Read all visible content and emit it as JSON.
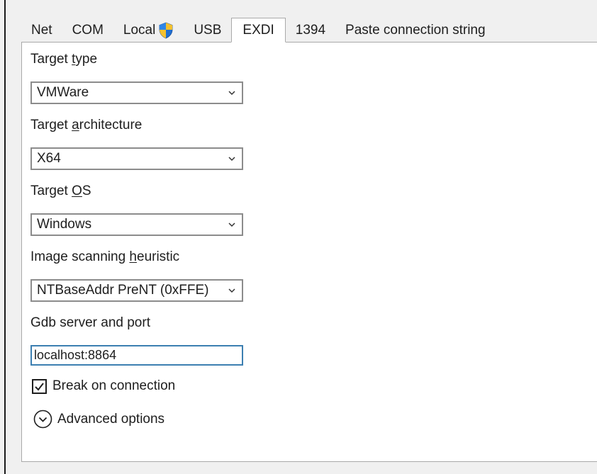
{
  "tabs": [
    {
      "label": "Net"
    },
    {
      "label": "COM"
    },
    {
      "label": "Local"
    },
    {
      "label": "USB"
    },
    {
      "label": "EXDI"
    },
    {
      "label": "1394"
    },
    {
      "label": "Paste connection string"
    }
  ],
  "selected_tab": "EXDI",
  "fields": {
    "target_type": {
      "label_pre": "Target ",
      "label_key": "t",
      "label_post": "ype",
      "value": "VMWare"
    },
    "target_arch": {
      "label_pre": "Target ",
      "label_key": "a",
      "label_post": "rchitecture",
      "value": "X64"
    },
    "target_os": {
      "label_pre": "Target ",
      "label_key": "O",
      "label_post": "S",
      "value": "Windows"
    },
    "image_scan": {
      "label_pre": "Image scanning ",
      "label_key": "h",
      "label_post": "euristic",
      "value": "NTBaseAddr PreNT (0xFFE)"
    },
    "gdb_server": {
      "label": "Gdb server and port",
      "value": "localhost:8864"
    }
  },
  "break_on_connection": {
    "label": "Break on connection",
    "checked": true
  },
  "advanced_options": {
    "label": "Advanced options"
  },
  "colors": {
    "background": "#f0f0f0",
    "panel": "#ffffff",
    "focus_border": "#3c7fb1",
    "shield_blue": "#1f6fd1",
    "shield_yellow": "#f5c12e"
  }
}
